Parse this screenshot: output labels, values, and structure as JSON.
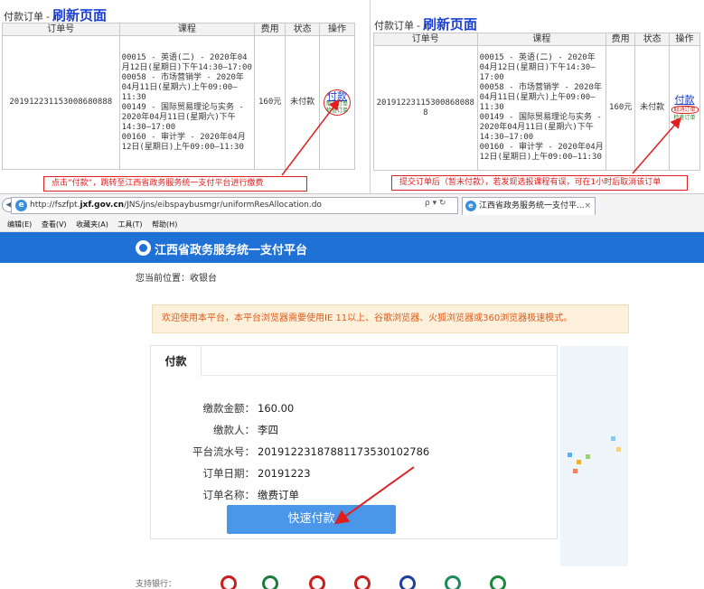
{
  "left_panel": {
    "title_label": "付款订单",
    "title_sep": "-",
    "refresh_label": "刷新页面",
    "headers": [
      "订单号",
      "课程",
      "费用",
      "状态",
      "操作"
    ],
    "order_id": "20191223115300868088​8",
    "courses": [
      "00015 - 英语(二) - 2020年04月12日(星期日)下午14:30—17:00",
      "00058 - 市场营销学 - 2020年04月11日(星期六)上午09:00—11:30",
      "00149 - 国际贸易理论与实务 - 2020年04月11日(星期六)下午14:30—17:00",
      "00160 - 审计学 - 2020年04月12日(星期日)上午09:00—11:30"
    ],
    "fee": "160元",
    "status": "未付款",
    "op_pay": "付款",
    "op_cancel": "取消订单",
    "op_check": "检查订单",
    "callout": "点击“付款”，跳转至江西省政务服务统一支付平台进行缴费"
  },
  "right_panel": {
    "title_label": "付款订单",
    "title_sep": "-",
    "refresh_label": "刷新页面",
    "headers": [
      "订单号",
      "课程",
      "费用",
      "状态",
      "操作"
    ],
    "order_id": "20191223115300868088​8",
    "courses": [
      "00015 - 英语(二) - 2020年04月12日(星期日)下午14:30—17:00",
      "00058 - 市场营销学 - 2020年04月11日(星期六)上午09:00—11:30",
      "00149 - 国际贸易理论与实务 - 2020年04月11日(星期六)下午14:30—17:00",
      "00160 - 审计学 - 2020年04月12日(星期日)上午09:00—11:30"
    ],
    "fee": "160元",
    "status": "未付款",
    "op_pay": "付款",
    "op_cancel": "取消订单",
    "op_check": "检查订单",
    "callout": "提交订单后（暂未付款），若发现选报课程有误，可在1小时后取消该订单"
  },
  "browser": {
    "url_prefix": "http://fszfpt.",
    "url_domain": "jxf.gov.cn",
    "url_path": "/JNS/jns/eibspaybusmgr/uniformResAllocation.do",
    "addr_tools": "ρ ▾ ↻",
    "tab_title": "江西省政务服务统一支付平...",
    "tab_close": "×",
    "menu": [
      "编辑(E)",
      "查看(V)",
      "收藏夹(A)",
      "工具(T)",
      "帮助(H)"
    ]
  },
  "site": {
    "title": "江西省政务服务统一支付平台",
    "location": "您当前位置：收银台",
    "notice": "欢迎使用本平台，本平台浏览器需要使用IE 11以上、谷歌浏览器、火狐浏览器或360浏览器极速模式。",
    "tab_label": "付款",
    "fields": [
      {
        "key": "缴款金额：",
        "value": "160.00"
      },
      {
        "key": "缴款人：",
        "value": "李四"
      },
      {
        "key": "平台流水号：",
        "value": "20191223187881173530102786"
      },
      {
        "key": "订单日期：",
        "value": "20191223"
      },
      {
        "key": "订单名称：",
        "value": "缴费订单"
      }
    ],
    "pay_button": "快速付款"
  },
  "colors": {
    "banner": "#1f71d6",
    "button": "#4a96e8",
    "annotation_red": "#e02020",
    "refresh_blue": "#1a3fd6",
    "notice_bg": "#fdf1dc",
    "notice_text": "#e05a1a"
  },
  "banks": {
    "label": "支持银行：",
    "icons": [
      {
        "name": "bank-icon-1",
        "color": "#c81e1e"
      },
      {
        "name": "bank-icon-2",
        "color": "#1a7a3a"
      },
      {
        "name": "bank-icon-3",
        "color": "#c81e1e"
      },
      {
        "name": "bank-icon-4",
        "color": "#c81e1e"
      },
      {
        "name": "bank-icon-5",
        "color": "#1e3f9a"
      },
      {
        "name": "bank-icon-6",
        "color": "#1a8a5a"
      },
      {
        "name": "bank-icon-7",
        "color": "#1a8a3a"
      }
    ]
  }
}
